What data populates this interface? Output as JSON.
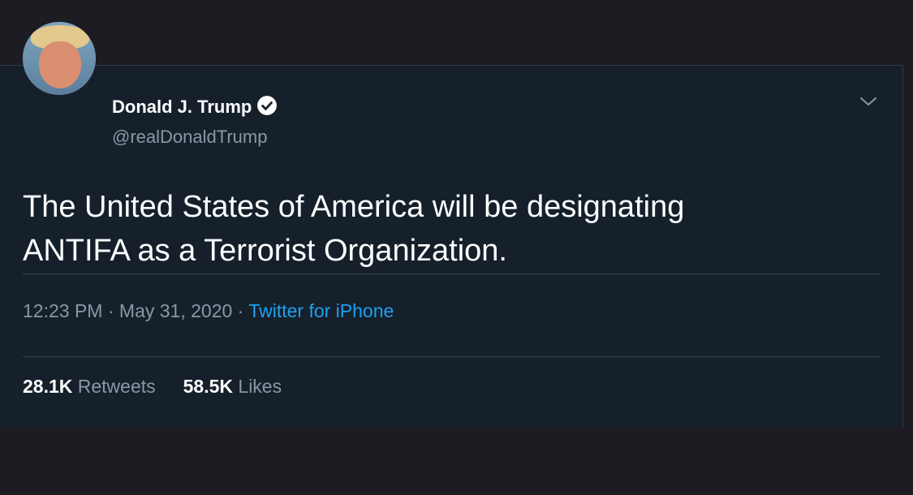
{
  "tweet": {
    "display_name": "Donald J. Trump",
    "handle": "@realDonaldTrump",
    "verified": true,
    "text_line1": "The United States of America will be designating",
    "text_line2": "ANTIFA as a Terrorist Organization.",
    "time": "12:23 PM",
    "separator": "·",
    "date": "May 31, 2020",
    "source": "Twitter for iPhone",
    "retweets_count": "28.1K",
    "retweets_label": "Retweets",
    "likes_count": "58.5K",
    "likes_label": "Likes"
  },
  "icons": {
    "verified": "verified-badge-icon",
    "menu": "chevron-down-icon"
  },
  "colors": {
    "background": "#15202b",
    "text": "#ffffff",
    "muted": "#8899a6",
    "link": "#1da1f2"
  }
}
